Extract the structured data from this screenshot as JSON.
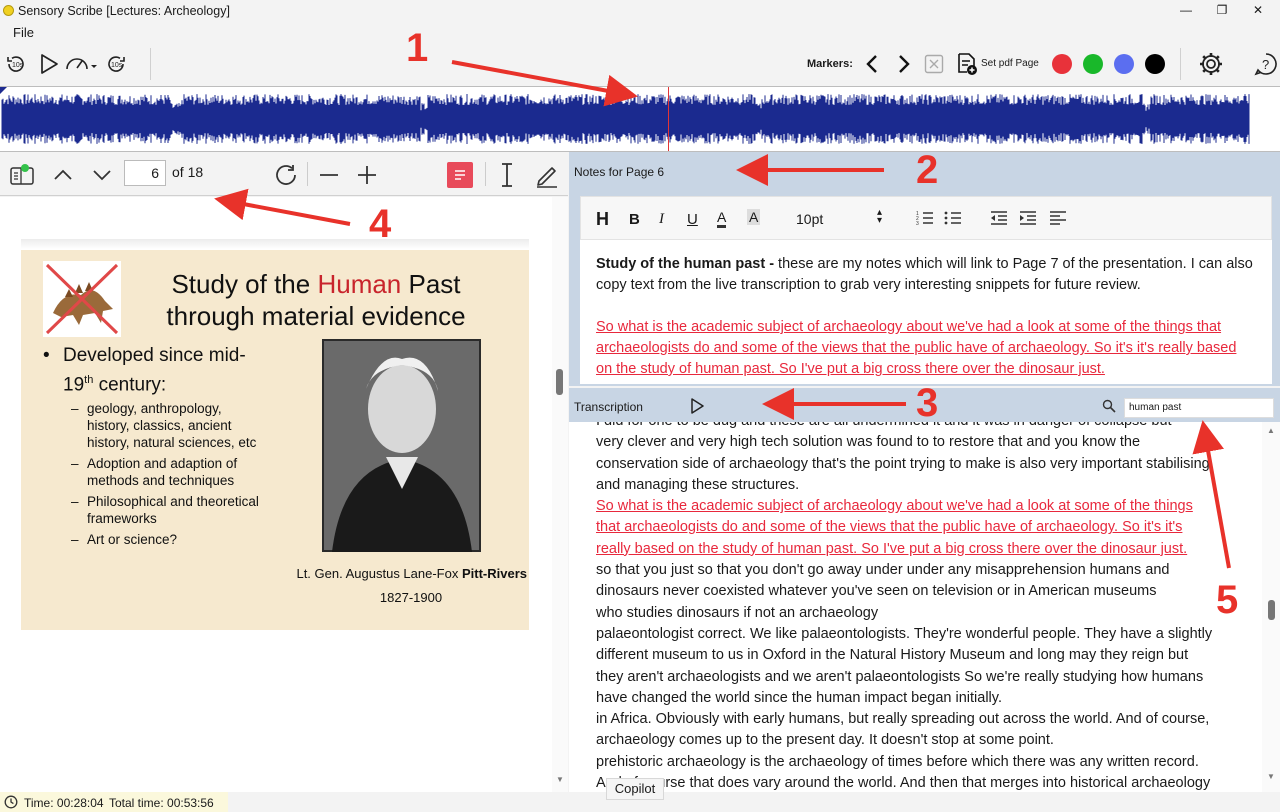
{
  "window": {
    "title": "Sensory Scribe [Lectures: Archeology]"
  },
  "menu": {
    "file": "File"
  },
  "toolbar": {
    "markers_label": "Markers:",
    "set_pdf_page": "Set pdf Page",
    "marker_colors": [
      "#e8323a",
      "#19b82a",
      "#5b6ef0",
      "#000000"
    ]
  },
  "pdf": {
    "current_page": "6",
    "of_pages": "of 18",
    "slide": {
      "title_pre": "Study of the ",
      "title_highlight": "Human",
      "title_post": " Past",
      "title_line2": "through material evidence",
      "bullet1_a": "Developed since mid-",
      "bullet1_b": "19",
      "bullet1_sup": "th",
      "bullet1_c": " century:",
      "sub1": "geology, anthropology, history, classics, ancient history, natural sciences, etc",
      "bullet2": "Adoption and adaption of methods and techniques",
      "bullet3": "Philosophical and theoretical frameworks",
      "bullet4": "Art or science?",
      "caption_name": "Lt. Gen. Augustus Lane-Fox ",
      "caption_bold": "Pitt-Rivers",
      "caption_years": "1827-1900"
    }
  },
  "notes": {
    "header": "Notes for Page 6",
    "font_size": "10pt",
    "para1_bold": "Study of the human past -",
    "para1_rest": " these are my notes which will link to Page 7 of the presentation. I can also copy text from the live transcription to grab very interesting snippets for future review.",
    "para2": "So what is the academic subject of archaeology about we've had a look at some of the things that archaeologists do and some of the views that the public have of archaeology. So it's it's really based on the study of human past. So I've put a big cross there over the dinosaur just."
  },
  "transcription": {
    "header": "Transcription",
    "search_value": "human past",
    "lines": [
      "I did for one to be dug and these are all undermined it and it was in danger of collapse but",
      "very clever and very high tech solution was found to to restore that and you know the",
      "conservation side of archaeology that's the point trying to make is also very important stabilising",
      "and managing these structures.",
      "So what is the academic subject of archaeology about we've had a look at some of the things",
      "that archaeologists do and some of the views that the public have of archaeology. So it's it's",
      "really based on the study of human past. So I've put a big cross there over the dinosaur just.",
      "so that you just so that you don't go away under under any misapprehension humans and",
      "dinosaurs never coexisted whatever you've seen on television or in American museums",
      "who studies dinosaurs if not an archaeology",
      "palaeontologist correct. We like palaeontologists. They're wonderful people. They have a slightly",
      "different museum to us in Oxford in the Natural History Museum and long may they reign but",
      "they aren't archaeologists and we aren't palaeontologists So we're really studying how humans",
      "have changed the world since the human impact began initially.",
      "in Africa. Obviously with early humans, but really spreading out across the world. And of course,",
      "archaeology comes up to the present day. It doesn't stop at some point.",
      "prehistoric archaeology is the archaeology of times before which there was any written record.",
      "And of course that does vary around the world. And then that merges into historical archaeology"
    ],
    "highlight_lines": [
      4,
      5,
      6
    ]
  },
  "status": {
    "time": "Time: 00:28:04",
    "total_time": "Total time: 00:53:56"
  },
  "copilot": "Copilot",
  "annotations": [
    "1",
    "2",
    "3",
    "4",
    "5"
  ]
}
